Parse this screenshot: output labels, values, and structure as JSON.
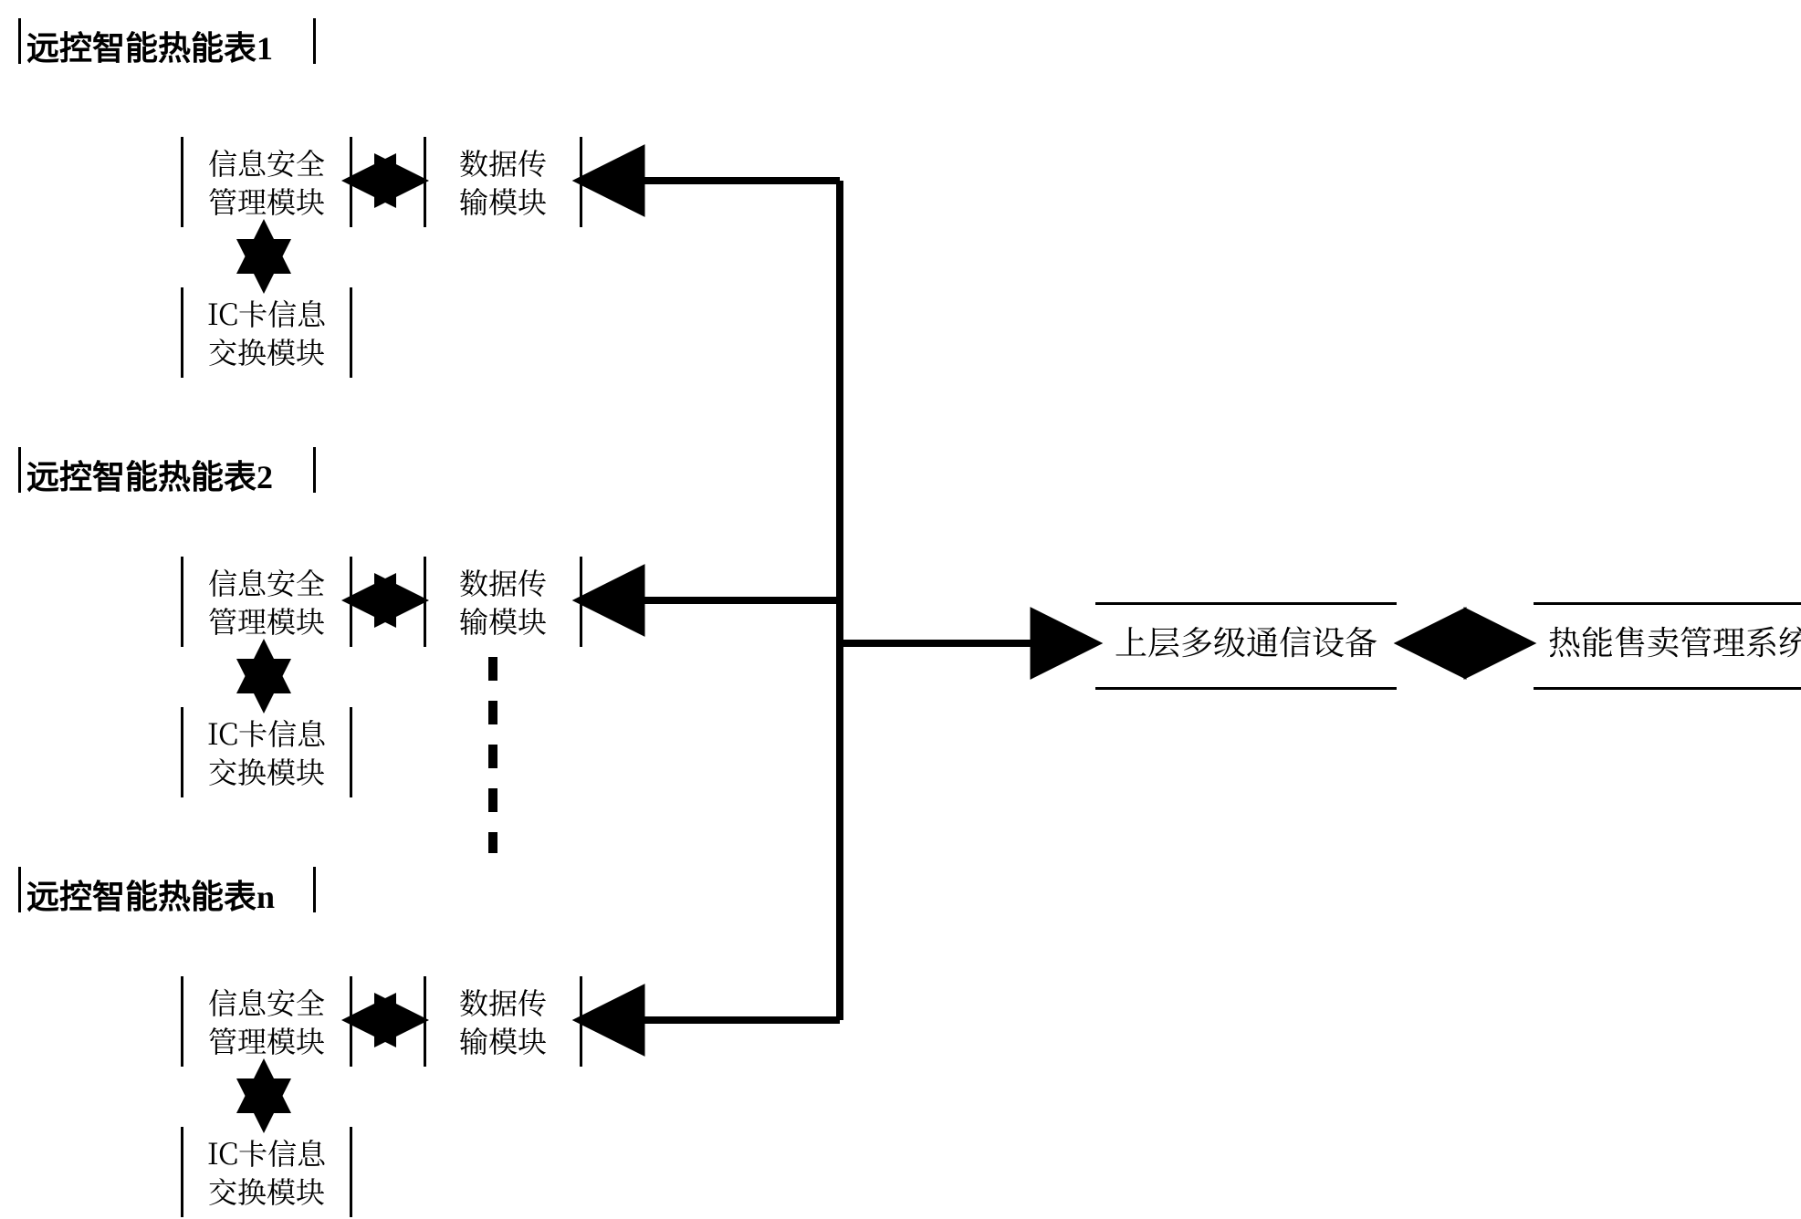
{
  "meter1": {
    "title": "远控智能热能表1",
    "sec": "信息安全\n管理模块",
    "data": "数据传\n输模块",
    "ic": "IC卡信息\n交换模块"
  },
  "meter2": {
    "title": "远控智能热能表2",
    "sec": "信息安全\n管理模块",
    "data": "数据传\n输模块",
    "ic": "IC卡信息\n交换模块"
  },
  "meterN": {
    "title": "远控智能热能表n",
    "sec": "信息安全\n管理模块",
    "data": "数据传\n输模块",
    "ic": "IC卡信息\n交换模块"
  },
  "right": {
    "comm": "上层多级通信设备",
    "mgmt": "热能售卖管理系统"
  }
}
